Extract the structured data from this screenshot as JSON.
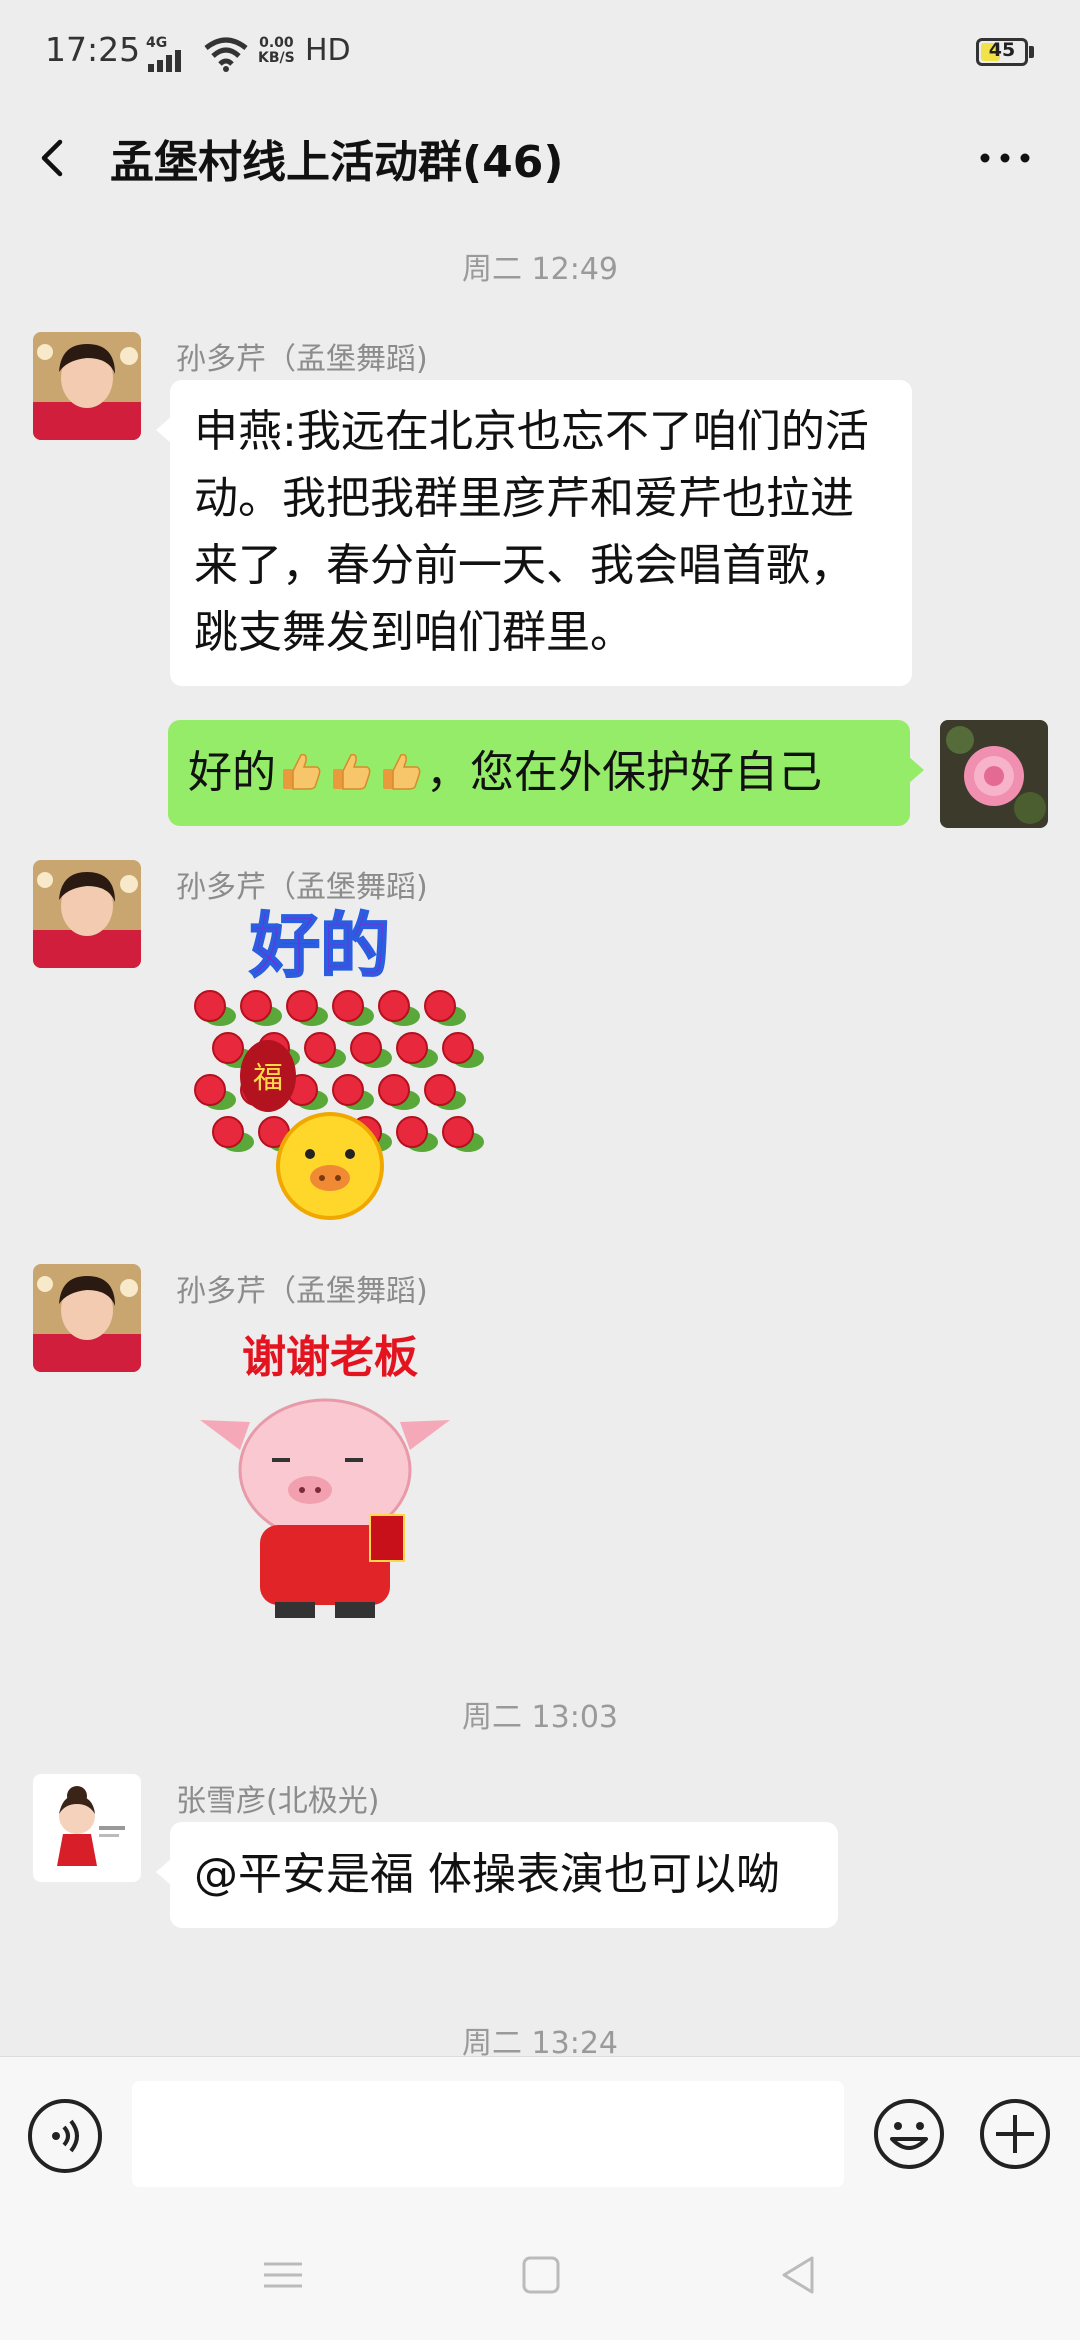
{
  "status_bar": {
    "time": "17:25",
    "network": "4G",
    "speed_value": "0.00",
    "speed_unit": "KB/S",
    "hd": "HD",
    "battery": "45",
    "battery_level_percent": 45
  },
  "header": {
    "title": "孟堡村线上活动群(46)",
    "back_icon": "chevron-left-icon",
    "more_icon": "more-dots-icon"
  },
  "chat": {
    "timestamps": [
      "周二 12:49",
      "周二 13:03",
      "周二 13:24"
    ],
    "messages": [
      {
        "sender": "孙多芹（孟堡舞蹈)",
        "type": "text",
        "lines": [
          "申燕:我远在北京也忘不了咱们的活",
          "动。我把我群里彦芹和爱芹也拉进",
          "来了，春分前一天、我会唱首歌，",
          "跳支舞发到咱们群里。"
        ]
      },
      {
        "sender": "me",
        "type": "text",
        "text_before": "好的",
        "text_after": "，您在外保护好自己",
        "emoji": "thumbs-up-icon",
        "emoji_count": 3
      },
      {
        "sender": "孙多芹（孟堡舞蹈)",
        "type": "sticker",
        "sticker_text": "好的",
        "lantern_text": "福"
      },
      {
        "sender": "孙多芹（孟堡舞蹈)",
        "type": "sticker",
        "sticker_text": "谢谢老板"
      },
      {
        "sender": "张雪彦(北极光)",
        "type": "text",
        "text": "@平安是福  体操表演也可以呦"
      }
    ]
  },
  "input_bar": {
    "placeholder": "",
    "voice_icon": "voice-icon",
    "emoji_icon": "emoji-icon",
    "plus_icon": "plus-icon"
  },
  "nav_bar": {
    "menu_icon": "menu-icon",
    "home_icon": "home-icon",
    "back_icon": "back-triangle-icon"
  },
  "colors": {
    "background": "#ededed",
    "my_bubble": "#95ec69",
    "other_bubble": "#ffffff",
    "timestamp_text": "#9a9a9a",
    "battery": "#f2e24a"
  }
}
